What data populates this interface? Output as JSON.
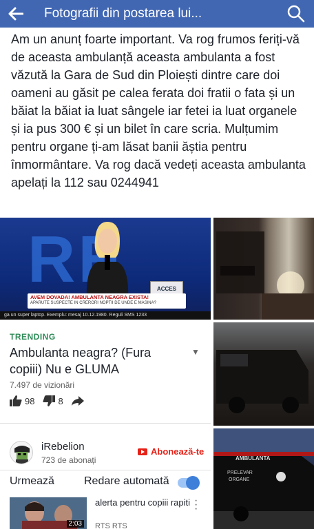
{
  "topbar": {
    "title": "Fotografii din postarea lui...",
    "back_icon": "arrow-left-icon",
    "search_icon": "search-icon",
    "color": "#4267b2"
  },
  "post": {
    "text": "Am un anunț foarte important. Va rog frumos feriți-vă de aceasta ambulanță aceasta ambulanta a fost văzută la Gara de Sud din Ploiești dintre care doi oameni au găsit pe calea ferata doi fratii o fata și un băiat la băiat ia luat sângele iar fetei ia luat organele și ia pus 300 € și un bilet în care scria. Mulțumim pentru organe ți-am lăsat banii ăștia pentru înmormântare. Va rog dacă vedeți aceasta ambulanta apelați la 112 sau 0244941"
  },
  "screenshot": {
    "tv": {
      "ticker_headline": "AVEM DOVADA! AMBULANTA NEAGRA EXISTA!",
      "ticker_sub": "APARUTE SUSPECTE IN CRERORI NOPTII DE UNDE E MASINA?",
      "channel_logo": "ACCES DIRECT",
      "bottom_strip": "ga un super laptop. Exemplu: mesaj 10.12.1980. Reguli SMS 1233"
    },
    "video": {
      "trending_label": "TRENDING",
      "title": "Ambulanta neagra? (Fura copiii) Nu e GLUMA",
      "views": "7.497 de vizionări",
      "likes": "98",
      "dislikes": "8"
    },
    "channel": {
      "name": "iRebelion",
      "subscribers": "723 de abonați",
      "subscribe_label": "Abonează-te"
    },
    "up_next": {
      "label": "Urmează",
      "autoplay_label": "Redare automată",
      "autoplay_on": true,
      "next_title": "alerta pentru copiii rapiti",
      "next_channel": "RTS RTS",
      "next_duration": "2:03"
    }
  }
}
